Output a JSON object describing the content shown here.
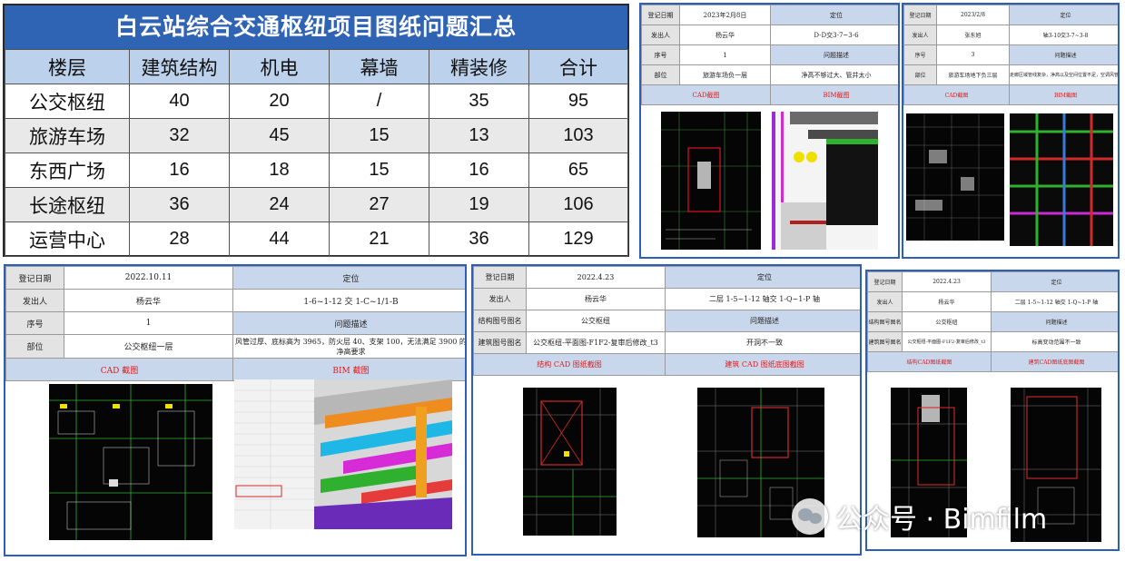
{
  "summary": {
    "title": "白云站综合交通枢纽项目图纸问题汇总",
    "headers": [
      "楼层",
      "建筑结构",
      "机电",
      "幕墙",
      "精装修",
      "合计"
    ],
    "rows": [
      [
        "公交枢纽",
        "40",
        "20",
        "/",
        "35",
        "95"
      ],
      [
        "旅游车场",
        "32",
        "45",
        "15",
        "13",
        "103"
      ],
      [
        "东西广场",
        "16",
        "18",
        "15",
        "16",
        "65"
      ],
      [
        "长途枢纽",
        "36",
        "24",
        "27",
        "19",
        "106"
      ],
      [
        "运营中心",
        "28",
        "44",
        "21",
        "36",
        "129"
      ]
    ]
  },
  "sheet_a": {
    "labels": [
      "登记日期",
      "发出人",
      "序号",
      "部位"
    ],
    "values": [
      "2023年2月8日",
      "杨云华",
      "1",
      "旅游车场负一层"
    ],
    "right_heads": [
      "定位",
      "问题描述"
    ],
    "right_values": [
      "D-D交3-7~3-6",
      "净高不够过大、管井太小"
    ],
    "cad_label": "CAD截图",
    "bim_label": "BIM截图"
  },
  "sheet_b": {
    "labels": [
      "登记日期",
      "发出人",
      "序号",
      "部位"
    ],
    "values": [
      "2023/2/8",
      "张东旭",
      "3",
      "旅游车场地下负三层"
    ],
    "right_heads": [
      "定位",
      "问题描述"
    ],
    "right_values": [
      "轴3-10交3-7~3-8",
      "走廊区域管线复杂，净高以及空间位置不足，空调风管被遮挡"
    ],
    "cad_label": "CAD截图",
    "bim_label": "BIM截图"
  },
  "sheet_c": {
    "labels": [
      "登记日期",
      "发出人",
      "序号",
      "部位"
    ],
    "values": [
      "2022.10.11",
      "杨云华",
      "1",
      "公交枢纽一层"
    ],
    "right_heads": [
      "定位",
      "问题描述"
    ],
    "right_values": [
      "1-6~1-12 交 1-C~1/1-B",
      "风管过厚、底标高为 3965，防火层 40、支架 100，无法满足 3900 的净高要求"
    ],
    "cad_label": "CAD 截图",
    "bim_label": "BIM 截图"
  },
  "sheet_d": {
    "labels": [
      "登记日期",
      "发出人",
      "结构图号图名",
      "建筑图号图名"
    ],
    "values": [
      "2022.4.23",
      "杨云华",
      "公交枢纽",
      "公交枢纽-平面图-F1F2-复审后修改_t3"
    ],
    "right_heads": [
      "定位",
      "问题描述"
    ],
    "right_values": [
      "二层 1-5~1-12 轴交 1-Q~1-P 轴",
      "开洞不一致"
    ],
    "cad_label": "结构 CAD 图纸截图",
    "bim_label": "建筑 CAD 图纸底图截图"
  },
  "sheet_e": {
    "labels": [
      "登记日期",
      "发出人",
      "结构图号图名",
      "建筑图号图名"
    ],
    "values": [
      "2022.4.23",
      "杨云华",
      "公交枢纽",
      "公交枢纽-平面图-F1F2-复审后修改_t3"
    ],
    "right_heads": [
      "定位",
      "问题描述"
    ],
    "right_values": [
      "二层 1-5~1-12 轴交 1-Q~1-P 轴",
      "标高变动范围不一致"
    ],
    "cad_label": "结构CAD图纸截图",
    "bim_label": "建筑CAD图纸底图截图"
  },
  "watermark": {
    "text": "公众号 · Bimfilm"
  }
}
